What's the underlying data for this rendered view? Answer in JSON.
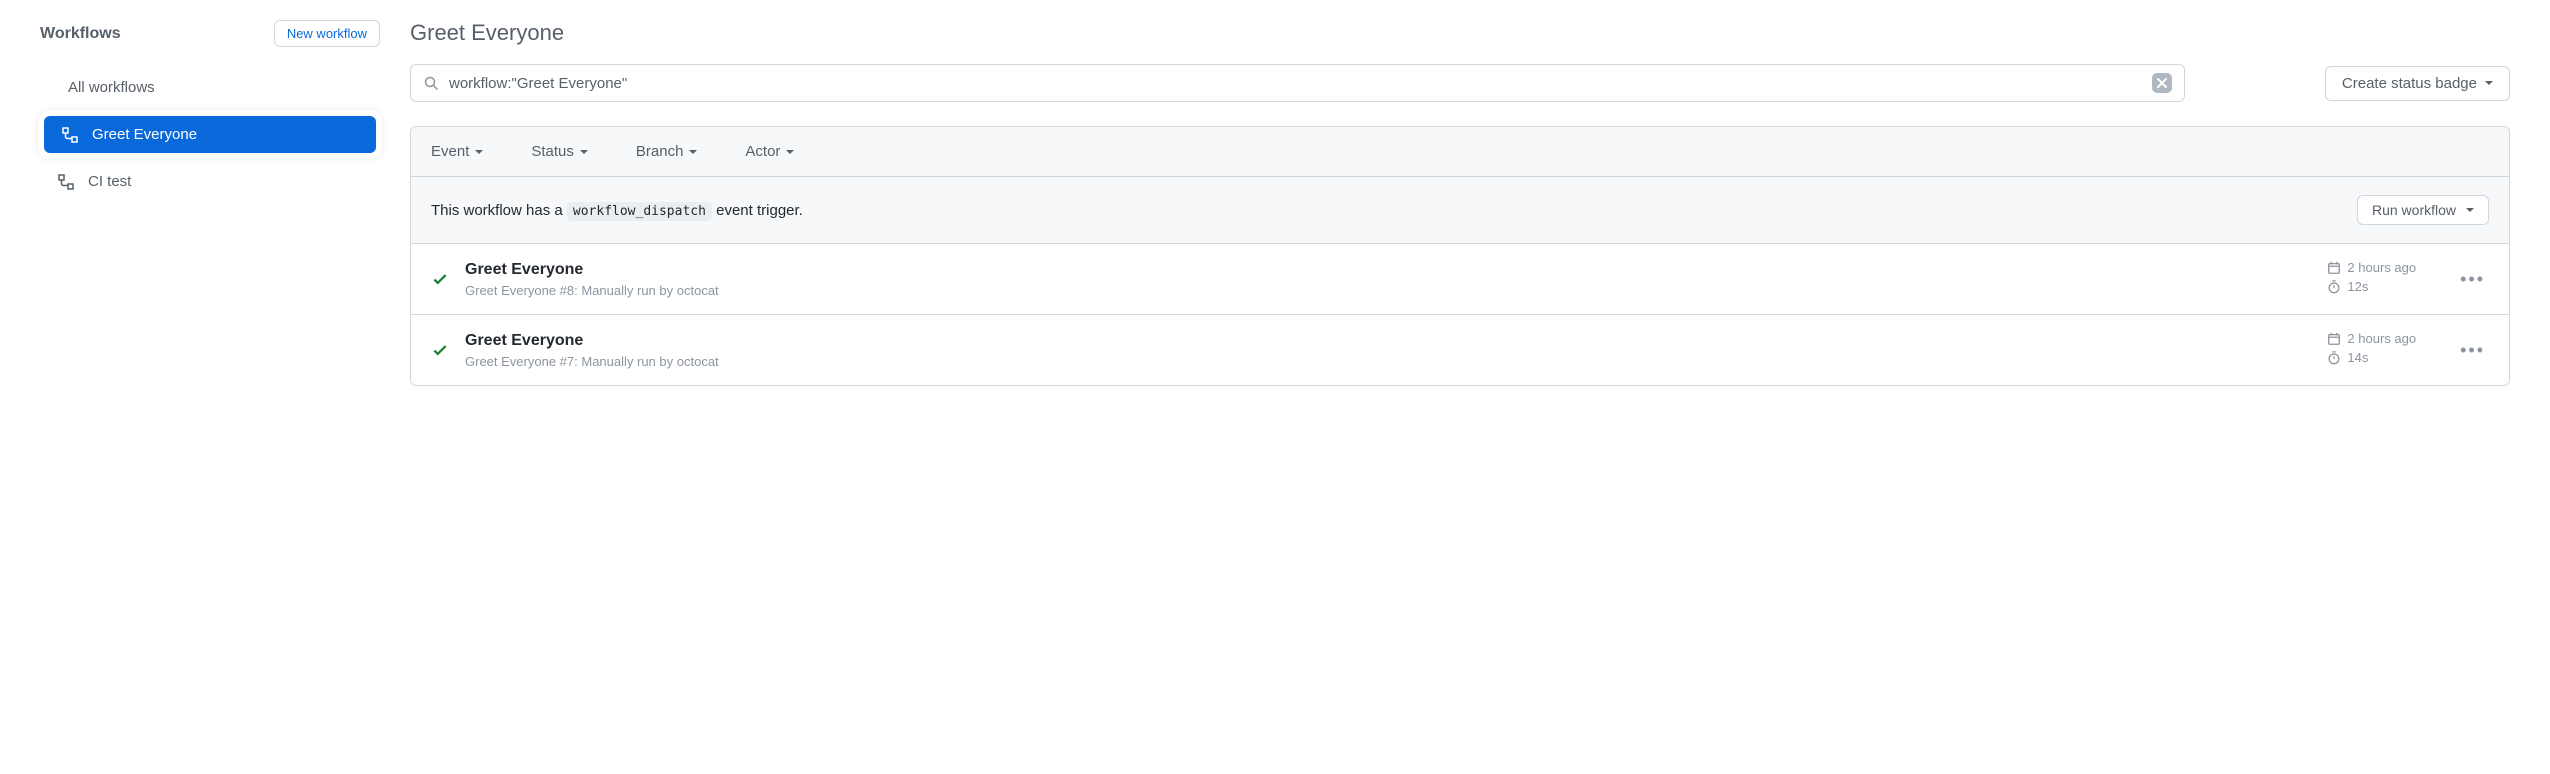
{
  "sidebar": {
    "title": "Workflows",
    "new_workflow_label": "New workflow",
    "all_label": "All workflows",
    "items": [
      {
        "label": "Greet Everyone",
        "selected": true
      },
      {
        "label": "CI test",
        "selected": false
      }
    ]
  },
  "main": {
    "title": "Greet Everyone",
    "search_value": "workflow:\"Greet Everyone\"",
    "status_badge_label": "Create status badge",
    "filters": {
      "event": "Event",
      "status": "Status",
      "branch": "Branch",
      "actor": "Actor"
    },
    "dispatch": {
      "prefix": "This workflow has a ",
      "code": "workflow_dispatch",
      "suffix": " event trigger.",
      "run_label": "Run workflow"
    },
    "runs": [
      {
        "title": "Greet Everyone",
        "workflow": "Greet Everyone",
        "number": "#8",
        "desc": ": Manually run by octocat",
        "time": "2 hours ago",
        "duration": "12s"
      },
      {
        "title": "Greet Everyone",
        "workflow": "Greet Everyone",
        "number": "#7",
        "desc": ": Manually run by octocat",
        "time": "2 hours ago",
        "duration": "14s"
      }
    ]
  }
}
